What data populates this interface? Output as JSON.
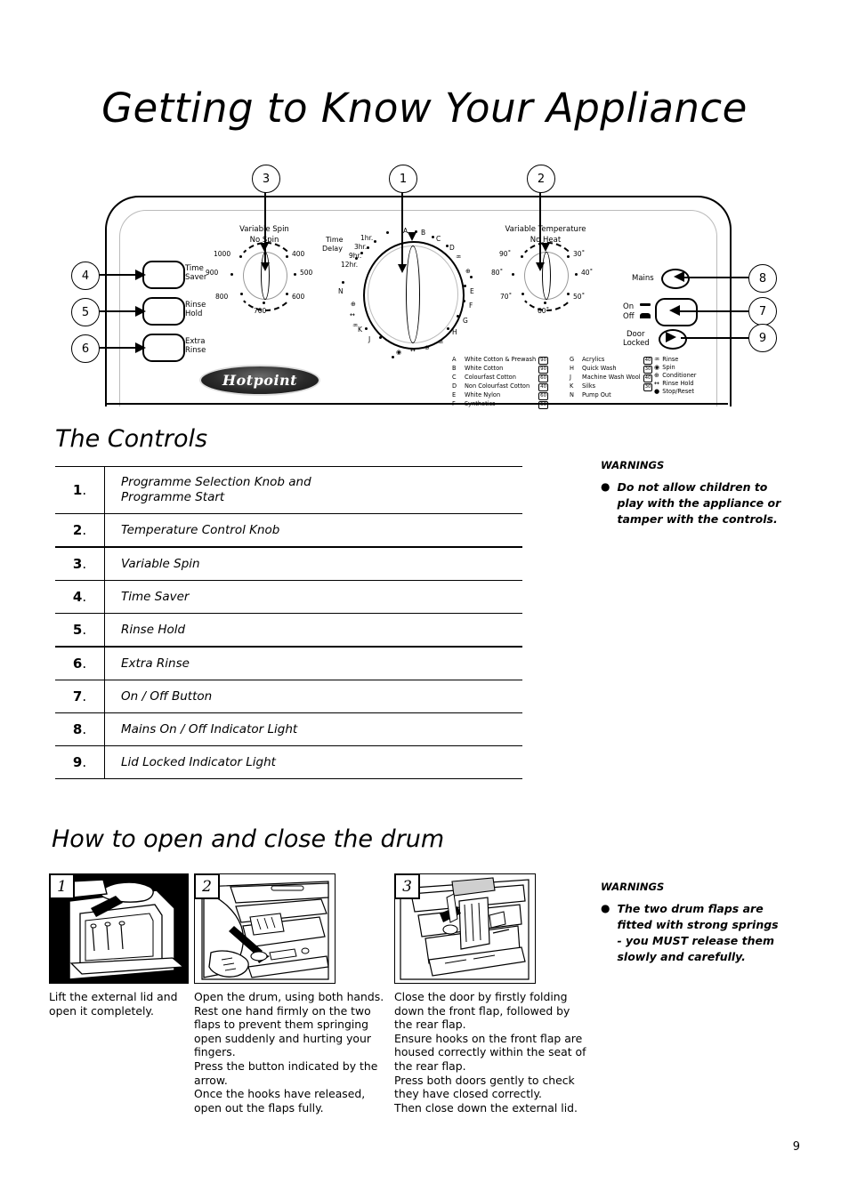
{
  "page_title": "Getting to Know Your Appliance",
  "page_number": "9",
  "panel": {
    "brand": "Hotpoint",
    "callouts": [
      "1",
      "2",
      "3",
      "4",
      "5",
      "6",
      "7",
      "8",
      "9"
    ],
    "spin_knob": {
      "title": "Variable Spin",
      "subtitle": "No Spin",
      "values": [
        "1000",
        "900",
        "800",
        "700",
        "600",
        "500",
        "400"
      ]
    },
    "temperature_knob": {
      "title": "Variable Temperature",
      "subtitle": "No Heat",
      "values": [
        "90˚",
        "80˚",
        "70˚",
        "60˚",
        "50˚",
        "40˚",
        "30˚"
      ]
    },
    "programme_knob": {
      "time_delay_label_line1": "Time",
      "time_delay_label_line2": "Delay",
      "delays": [
        "1hr.",
        "3hr.",
        "9hr.",
        "12hr."
      ],
      "dial_letters": [
        "A",
        "B",
        "C",
        "D",
        "E",
        "F",
        "G",
        "H",
        "J",
        "K",
        "N"
      ]
    },
    "left_buttons": [
      {
        "callout": "4",
        "line1": "Time",
        "line2": "Saver"
      },
      {
        "callout": "5",
        "line1": "Rinse",
        "line2": "Hold"
      },
      {
        "callout": "6",
        "line1": "Extra",
        "line2": "Rinse"
      }
    ],
    "right_controls": {
      "mains_label": "Mains",
      "onoff_line1": "On",
      "onoff_line2": "Off",
      "door_line1": "Door",
      "door_line2": "Locked"
    },
    "programme_legend": {
      "column1": [
        {
          "key": "A",
          "name": "White Cotton & Prewash",
          "temp": "90"
        },
        {
          "key": "B",
          "name": "White Cotton",
          "temp": "90"
        },
        {
          "key": "C",
          "name": "Colourfast Cotton",
          "temp": "60"
        },
        {
          "key": "D",
          "name": "Non Colourfast Cotton",
          "temp": "40"
        },
        {
          "key": "E",
          "name": "White Nylon",
          "temp": "60"
        },
        {
          "key": "F",
          "name": "Synthetics",
          "temp": "50"
        }
      ],
      "column2": [
        {
          "key": "G",
          "name": "Acrylics",
          "temp": "40"
        },
        {
          "key": "H",
          "name": "Quick Wash",
          "temp": "30"
        },
        {
          "key": "J",
          "name": "Machine Wash Wool",
          "temp": "40"
        },
        {
          "key": "K",
          "name": "Silks",
          "temp": "30"
        },
        {
          "key": "N",
          "name": "Pump Out",
          "temp": ""
        }
      ],
      "symbols": [
        {
          "glyph": "♒",
          "name": "Rinse"
        },
        {
          "glyph": "◉",
          "name": "Spin"
        },
        {
          "glyph": "⊕",
          "name": "Conditioner"
        },
        {
          "glyph": "↔",
          "name": "Rinse Hold"
        },
        {
          "glyph": "●",
          "name": "Stop/Reset"
        }
      ]
    }
  },
  "controls_section": {
    "heading": "The Controls",
    "rows": [
      {
        "num": "1",
        "label": "Programme Selection Knob and\nProgramme Start"
      },
      {
        "num": "2",
        "label": "Temperature Control Knob"
      },
      {
        "num": "3",
        "label": "Variable Spin"
      },
      {
        "num": "4",
        "label": "Time Saver"
      },
      {
        "num": "5",
        "label": "Rinse Hold"
      },
      {
        "num": "6",
        "label": "Extra Rinse"
      },
      {
        "num": "7",
        "label": "On / Off Button"
      },
      {
        "num": "8",
        "label": "Mains On / Off Indicator Light"
      },
      {
        "num": "9",
        "label": "Lid Locked Indicator Light"
      }
    ],
    "warning": {
      "heading": "WARNINGS",
      "bullet": "●",
      "text": "Do not allow children to play with the appliance or tamper with the controls."
    }
  },
  "drum_section": {
    "heading": "How to open and close the drum",
    "steps": [
      {
        "num": "1",
        "caption": "Lift the external lid and open it completely."
      },
      {
        "num": "2",
        "caption": "Open the drum, using both hands.\nRest one hand firmly on the two\nflaps to prevent them springing\nopen suddenly and hurting your\nfingers.\nPress the button indicated by the\narrow.\nOnce the hooks have released,\nopen out the flaps fully."
      },
      {
        "num": "3",
        "caption": "Close the door by firstly folding\ndown the front flap, followed by\nthe rear flap.\nEnsure hooks on the front flap are\nhoused correctly within the seat of\nthe rear flap.\nPress both doors gently to check\nthey have closed correctly.\nThen close down the external lid."
      }
    ],
    "warning": {
      "heading": "WARNINGS",
      "bullet": "●",
      "text": "The two drum flaps are fitted with strong springs - you MUST release them slowly and carefully."
    }
  }
}
